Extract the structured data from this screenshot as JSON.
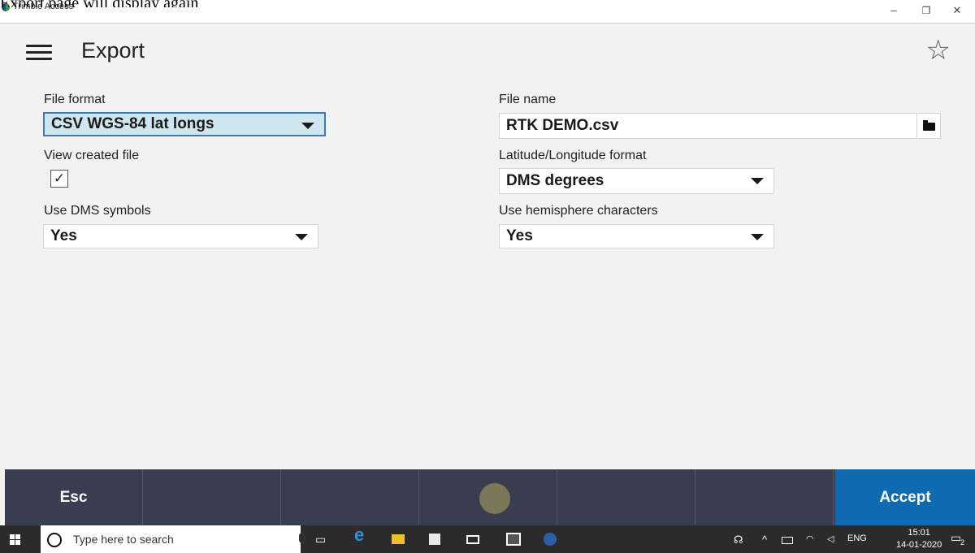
{
  "caption": "Export page will display again",
  "window": {
    "app_name": "Trimble Access",
    "minimize_glyph": "–",
    "restore_glyph": "❐",
    "close_glyph": "✕"
  },
  "header": {
    "title": "Export",
    "favorite_glyph": "☆"
  },
  "form": {
    "file_format": {
      "label": "File format",
      "value": "CSV WGS-84 lat longs"
    },
    "view_created_file": {
      "label": "View created file",
      "checked": true,
      "check_glyph": "✓"
    },
    "use_dms_symbols": {
      "label": "Use DMS symbols",
      "value": "Yes"
    },
    "file_name": {
      "label": "File name",
      "value": "RTK DEMO.csv"
    },
    "lat_long_format": {
      "label": "Latitude/Longitude format",
      "value": "DMS degrees"
    },
    "use_hemisphere": {
      "label": "Use hemisphere characters",
      "value": "Yes"
    }
  },
  "softkeys": {
    "esc": "Esc",
    "accept": "Accept",
    "accept_color": "#0f6bb1",
    "bar_color": "#3a3d4f"
  },
  "taskbar": {
    "search_placeholder": "Type here to search",
    "language": "ENG",
    "time": "15:01",
    "date": "14-01-2020",
    "notification_count": "2",
    "icons": [
      "windows-start-icon",
      "cortana-icon",
      "microphone-icon",
      "task-view-icon",
      "edge-icon",
      "file-explorer-icon",
      "store-icon",
      "mail-icon",
      "photos-icon",
      "trimble-access-icon",
      "people-icon",
      "chevron-up-icon",
      "battery-icon",
      "wifi-icon",
      "volume-icon",
      "notification-icon"
    ]
  }
}
